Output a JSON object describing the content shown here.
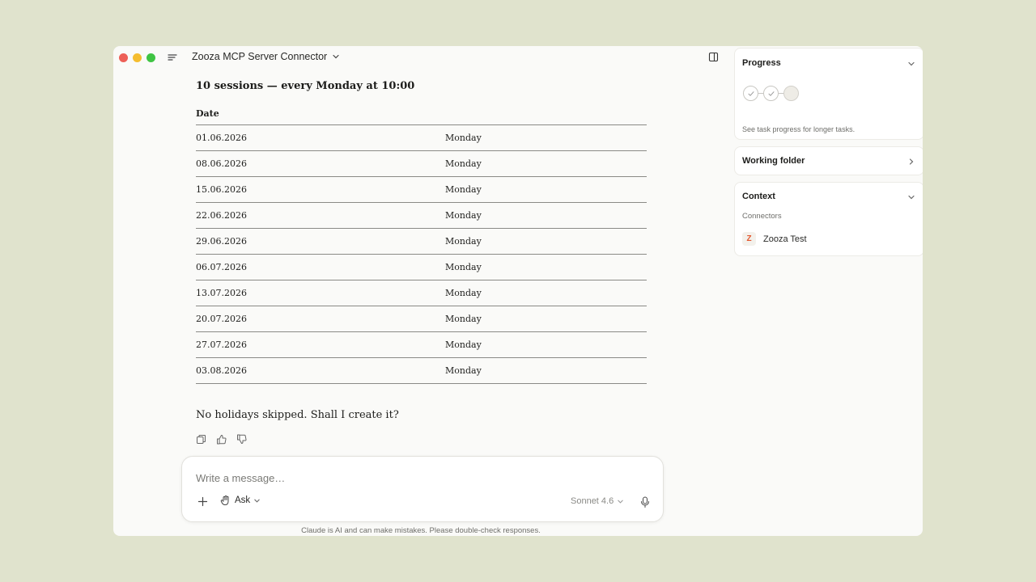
{
  "window": {
    "title": "Zooza MCP Server Connector"
  },
  "chat": {
    "heading": "10 sessions — every Monday at 10:00",
    "table": {
      "header": "Date",
      "rows": [
        {
          "date": "01.06.2026",
          "day": "Monday"
        },
        {
          "date": "08.06.2026",
          "day": "Monday"
        },
        {
          "date": "15.06.2026",
          "day": "Monday"
        },
        {
          "date": "22.06.2026",
          "day": "Monday"
        },
        {
          "date": "29.06.2026",
          "day": "Monday"
        },
        {
          "date": "06.07.2026",
          "day": "Monday"
        },
        {
          "date": "13.07.2026",
          "day": "Monday"
        },
        {
          "date": "20.07.2026",
          "day": "Monday"
        },
        {
          "date": "27.07.2026",
          "day": "Monday"
        },
        {
          "date": "03.08.2026",
          "day": "Monday"
        }
      ]
    },
    "followup": "No holidays skipped. Shall I create it?"
  },
  "composer": {
    "placeholder": "Write a message…",
    "mode_label": "Ask",
    "model_label": "Sonnet 4.6"
  },
  "disclaimer": "Claude is AI and can make mistakes. Please double-check responses.",
  "sidebar": {
    "progress": {
      "title": "Progress",
      "hint": "See task progress for longer tasks.",
      "steps": [
        "done",
        "done",
        "pending"
      ]
    },
    "working_folder": {
      "title": "Working folder"
    },
    "context": {
      "title": "Context",
      "connectors_label": "Connectors",
      "connectors": [
        {
          "name": "Zooza Test",
          "icon": "zooza-logo-icon"
        }
      ]
    }
  },
  "colors": {
    "background": "#e0e3cd",
    "window": "#fafaf8",
    "traffic_red": "#ed5f57",
    "traffic_yellow": "#f5bd2f",
    "traffic_green": "#3fc443",
    "accent_logo": "#e4572e"
  }
}
